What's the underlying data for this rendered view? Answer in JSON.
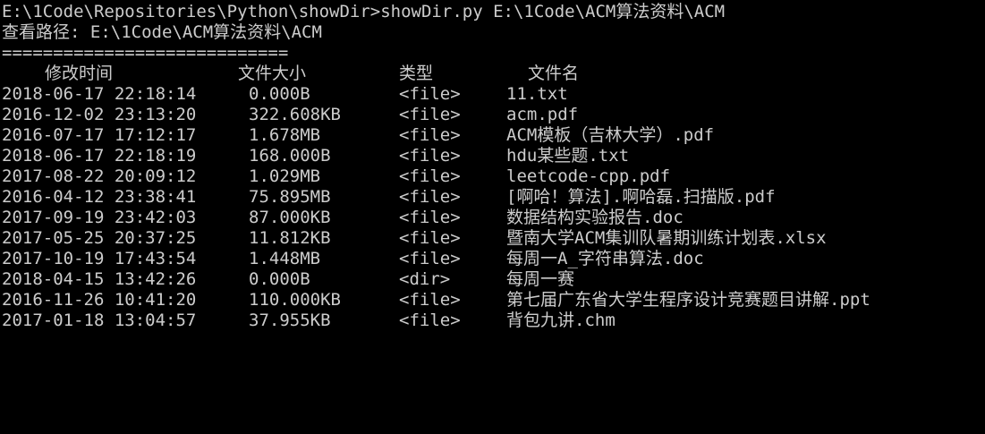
{
  "command_line": "E:\\1Code\\Repositories\\Python\\showDir>showDir.py E:\\1Code\\ACM算法资料\\ACM",
  "path_line": "查看路径: E:\\1Code\\ACM算法资料\\ACM",
  "separator": "============================",
  "headers": {
    "time": "修改时间",
    "size": "文件大小",
    "type": "类型",
    "name": "文件名"
  },
  "rows": [
    {
      "time": "2018-06-17 22:18:14",
      "size": "0.000B",
      "type": "<file>",
      "name": "11.txt"
    },
    {
      "time": "2016-12-02 23:13:20",
      "size": "322.608KB",
      "type": "<file>",
      "name": "acm.pdf"
    },
    {
      "time": "2016-07-17 17:12:17",
      "size": "1.678MB",
      "type": "<file>",
      "name": "ACM模板（吉林大学）.pdf"
    },
    {
      "time": "2018-06-17 22:18:19",
      "size": "168.000B",
      "type": "<file>",
      "name": "hdu某些题.txt"
    },
    {
      "time": "2017-08-22 20:09:12",
      "size": "1.029MB",
      "type": "<file>",
      "name": "leetcode-cpp.pdf"
    },
    {
      "time": "2016-04-12 23:38:41",
      "size": "75.895MB",
      "type": "<file>",
      "name": "[啊哈！算法].啊哈磊.扫描版.pdf"
    },
    {
      "time": "2017-09-19 23:42:03",
      "size": "87.000KB",
      "type": "<file>",
      "name": "数据结构实验报告.doc"
    },
    {
      "time": "2017-05-25 20:37:25",
      "size": "11.812KB",
      "type": "<file>",
      "name": "暨南大学ACM集训队暑期训练计划表.xlsx"
    },
    {
      "time": "2017-10-19 17:43:54",
      "size": "1.448MB",
      "type": "<file>",
      "name": "每周一A_字符串算法.doc"
    },
    {
      "time": "2018-04-15 13:42:26",
      "size": "0.000B",
      "type": "<dir>",
      "name": "每周一赛"
    },
    {
      "time": "2016-11-26 10:41:20",
      "size": "110.000KB",
      "type": "<file>",
      "name": "第七届广东省大学生程序设计竞赛题目讲解.ppt"
    },
    {
      "time": "2017-01-18 13:04:57",
      "size": "37.955KB",
      "type": "<file>",
      "name": "背包九讲.chm"
    }
  ]
}
